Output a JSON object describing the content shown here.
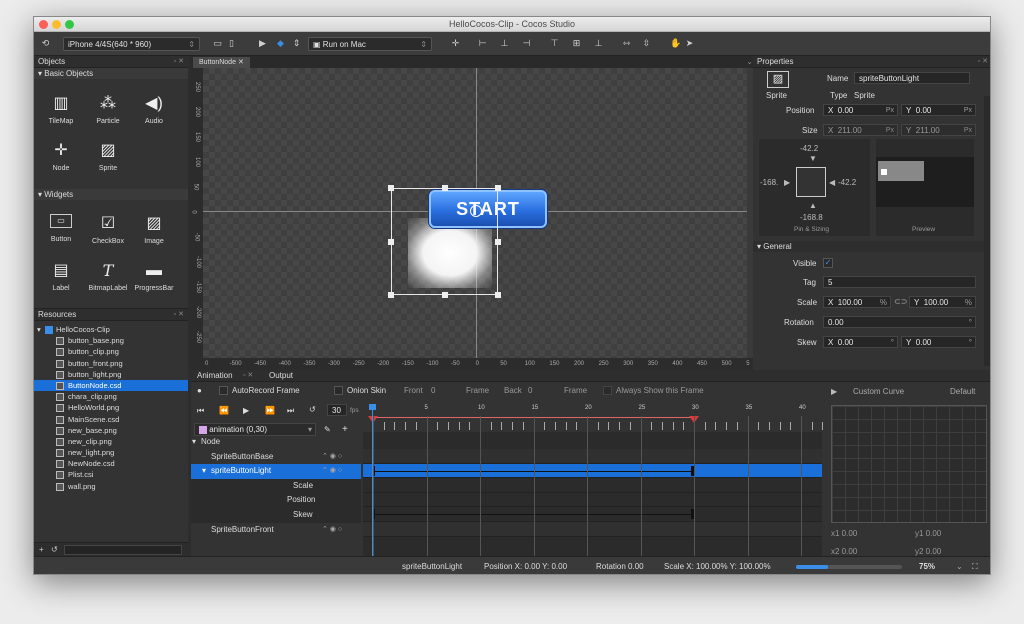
{
  "window": {
    "title": "HelloCocos-Clip - Cocos Studio"
  },
  "toolbar": {
    "device": "iPhone 4/4S(640 * 960)",
    "run_target": "Run on Mac"
  },
  "objects": {
    "header": "Objects",
    "basic_title": "Basic Objects",
    "basic": [
      "TileMap",
      "Particle",
      "Audio",
      "Node",
      "Sprite"
    ],
    "widgets_title": "Widgets",
    "widgets": [
      "Button",
      "CheckBox",
      "Image",
      "Label",
      "BitmapLabel",
      "ProgressBar"
    ]
  },
  "resources": {
    "header": "Resources",
    "root": "HelloCocos-Clip",
    "files": [
      "button_base.png",
      "button_clip.png",
      "button_front.png",
      "button_light.png",
      "ButtonNode.csd",
      "chara_clip.png",
      "HelloWorld.png",
      "MainScene.csd",
      "new_base.png",
      "new_clip.png",
      "new_light.png",
      "NewNode.csd",
      "Plist.csi",
      "wall.png"
    ],
    "selected_index": 4
  },
  "editor": {
    "tab": "ButtonNode",
    "button_text": "START",
    "v_ticks": [
      "250",
      "200",
      "150",
      "100",
      "50",
      "0",
      "-50",
      "-100",
      "-150",
      "-200",
      "-250"
    ],
    "h_ticks": [
      "0",
      "-500",
      "-450",
      "-400",
      "-350",
      "-300",
      "-250",
      "-200",
      "-150",
      "-100",
      "-50",
      "0",
      "50",
      "100",
      "150",
      "200",
      "250",
      "300",
      "350",
      "400",
      "450",
      "500",
      "5"
    ]
  },
  "properties": {
    "header": "Properties",
    "kind": "Sprite",
    "name_label": "Name",
    "name": "spriteButtonLight",
    "type_label": "Type",
    "type": "Sprite",
    "position_label": "Position",
    "pos_x": "0.00",
    "pos_y": "0.00",
    "unit": "Px",
    "size_label": "Size",
    "size_x": "211.00",
    "size_y": "211.00",
    "pin_top": "-42.2",
    "pin_left": "-168.",
    "pin_right": "-42.2",
    "pin_bottom": "-168.8",
    "pin_caption": "Pin & Sizing",
    "preview_caption": "Preview",
    "general": "General",
    "visible_label": "Visible",
    "tag_label": "Tag",
    "tag": "5",
    "scale_label": "Scale",
    "scale_x": "100.00",
    "scale_y": "100.00",
    "rotation_label": "Rotation",
    "rotation": "0.00",
    "skew_label": "Skew",
    "skew_x": "0.00",
    "skew_y": "0.00"
  },
  "animation": {
    "tab_anim": "Animation",
    "tab_output": "Output",
    "autorecord": "AutoRecord Frame",
    "onion": "Onion Skin",
    "front_label": "Front",
    "front": "0",
    "frame_label": "Frame",
    "back_label": "Back",
    "back": "0",
    "frame2_label": "Frame",
    "always_show": "Always Show this Frame",
    "fps": "30",
    "fps_unit": "fps",
    "anim_name": "animation (0,30)",
    "ruler": [
      "0",
      "5",
      "10",
      "15",
      "20",
      "25",
      "30",
      "35",
      "40"
    ],
    "tracks": [
      "Node",
      "SpriteButtonBase",
      "spriteButtonLight",
      "Scale",
      "Position",
      "Skew",
      "SpriteButtonFront"
    ],
    "curve_title": "Custom Curve",
    "curve_default": "Default",
    "x1": "x1  0.00",
    "y1": "y1  0.00",
    "x2": "x2  0.00",
    "y2": "y2  0.00"
  },
  "status": {
    "name": "spriteButtonLight",
    "position": "Position X: 0.00   Y: 0.00",
    "rotation": "Rotation  0.00",
    "scale": "Scale X: 100.00%   Y: 100.00%",
    "zoom": "75%",
    "zoom_value": 0.3
  },
  "colors": {
    "selection": "#1a6fd8",
    "button": "#2a6fe0",
    "keyframe": "#d93a3a"
  }
}
